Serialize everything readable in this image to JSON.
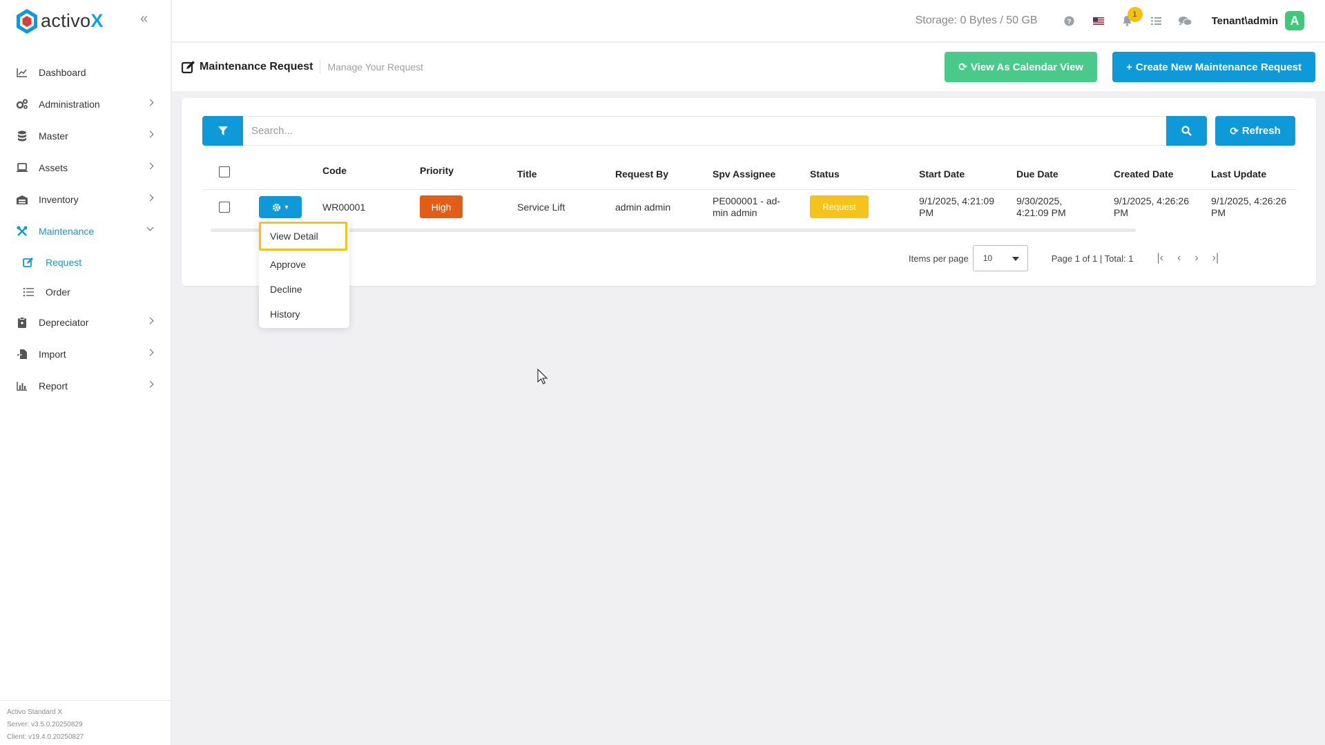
{
  "brand": {
    "name": "activo",
    "suffix": "X"
  },
  "sidebar": {
    "items": [
      {
        "label": "Dashboard",
        "icon": "chart-line-icon",
        "has_children": false
      },
      {
        "label": "Administration",
        "icon": "gears-icon",
        "has_children": true
      },
      {
        "label": "Master",
        "icon": "database-icon",
        "has_children": true
      },
      {
        "label": "Assets",
        "icon": "laptop-icon",
        "has_children": true
      },
      {
        "label": "Inventory",
        "icon": "warehouse-icon",
        "has_children": true
      },
      {
        "label": "Maintenance",
        "icon": "tools-icon",
        "has_children": true,
        "expanded": true,
        "active": true
      },
      {
        "label": "Depreciator",
        "icon": "clipboard-icon",
        "has_children": true
      },
      {
        "label": "Import",
        "icon": "file-import-icon",
        "has_children": true
      },
      {
        "label": "Report",
        "icon": "bar-chart-icon",
        "has_children": true
      }
    ],
    "sub_items": [
      {
        "label": "Request",
        "icon": "edit-icon",
        "active": true
      },
      {
        "label": "Order",
        "icon": "list-icon",
        "active": false
      }
    ],
    "footer": {
      "product": "Activo Standard X",
      "server": "Server: v3.5.0.20250829",
      "client": "Client: v19.4.0.20250827"
    }
  },
  "topbar": {
    "storage": "Storage: 0 Bytes / 50 GB",
    "notification_count": "1",
    "user": "Tenant\\admin",
    "avatar_letter": "A"
  },
  "header": {
    "title": "Maintenance Request",
    "subtitle": "Manage Your Request",
    "calendar_button": "View As Calendar View",
    "create_button": "Create New Maintenance Request"
  },
  "search": {
    "placeholder": "Search...",
    "refresh_label": "Refresh"
  },
  "table": {
    "columns": [
      "Code",
      "Priority",
      "Title",
      "Request By",
      "Spv Assignee",
      "Status",
      "Start Date",
      "Due Date",
      "Created Date",
      "Last Update"
    ],
    "rows": [
      {
        "code": "WR00001",
        "priority": "High",
        "title": "Service Lift",
        "request_by": "admin admin",
        "spv_line1": "PE000001 - ad-",
        "spv_line2": "min admin",
        "status": "Request",
        "start_line1": "9/1/2025, 4:21:09",
        "start_line2": "PM",
        "due_line1": "9/30/2025,",
        "due_line2": "4:21:09 PM",
        "created_line1": "9/1/2025, 4:26:26",
        "created_line2": "PM",
        "updated_line1": "9/1/2025, 4:26:26",
        "updated_line2": "PM"
      }
    ]
  },
  "pager": {
    "items_per_page_label": "Items per page",
    "items_per_page": "10",
    "info": "Page 1 of 1 | Total: 1"
  },
  "dropdown": {
    "items": [
      "View Detail",
      "Approve",
      "Decline",
      "History"
    ]
  },
  "colors": {
    "primary": "#0e9ad8",
    "success": "#49c98a",
    "priority_high": "#e35d16",
    "status_request": "#f6c318",
    "highlight": "#f6c318"
  }
}
